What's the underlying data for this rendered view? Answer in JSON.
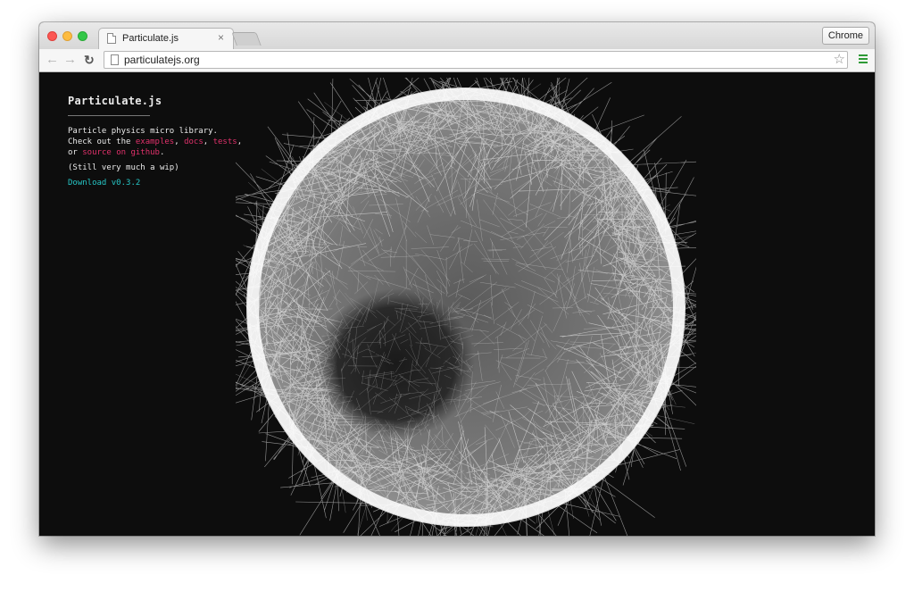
{
  "tab": {
    "title": "Particulate.js",
    "close": "×"
  },
  "profile_button": "Chrome",
  "omnibox": {
    "url": "particulatejs.org"
  },
  "page": {
    "title": "Particulate.js",
    "line1": "Particle physics micro library.",
    "line2_prefix": "Check out the ",
    "link_examples": "examples",
    "sep1": ", ",
    "link_docs": "docs",
    "sep2": ", ",
    "link_tests": "tests",
    "sep3": ",",
    "line3_prefix": "or ",
    "link_source": "source on github",
    "line3_suffix": ".",
    "wip": "(Still very much a wip)",
    "download": "Download v0.3.2"
  },
  "colors": {
    "link": "#e0316b",
    "download": "#26c6c6",
    "background": "#0d0d0d"
  }
}
